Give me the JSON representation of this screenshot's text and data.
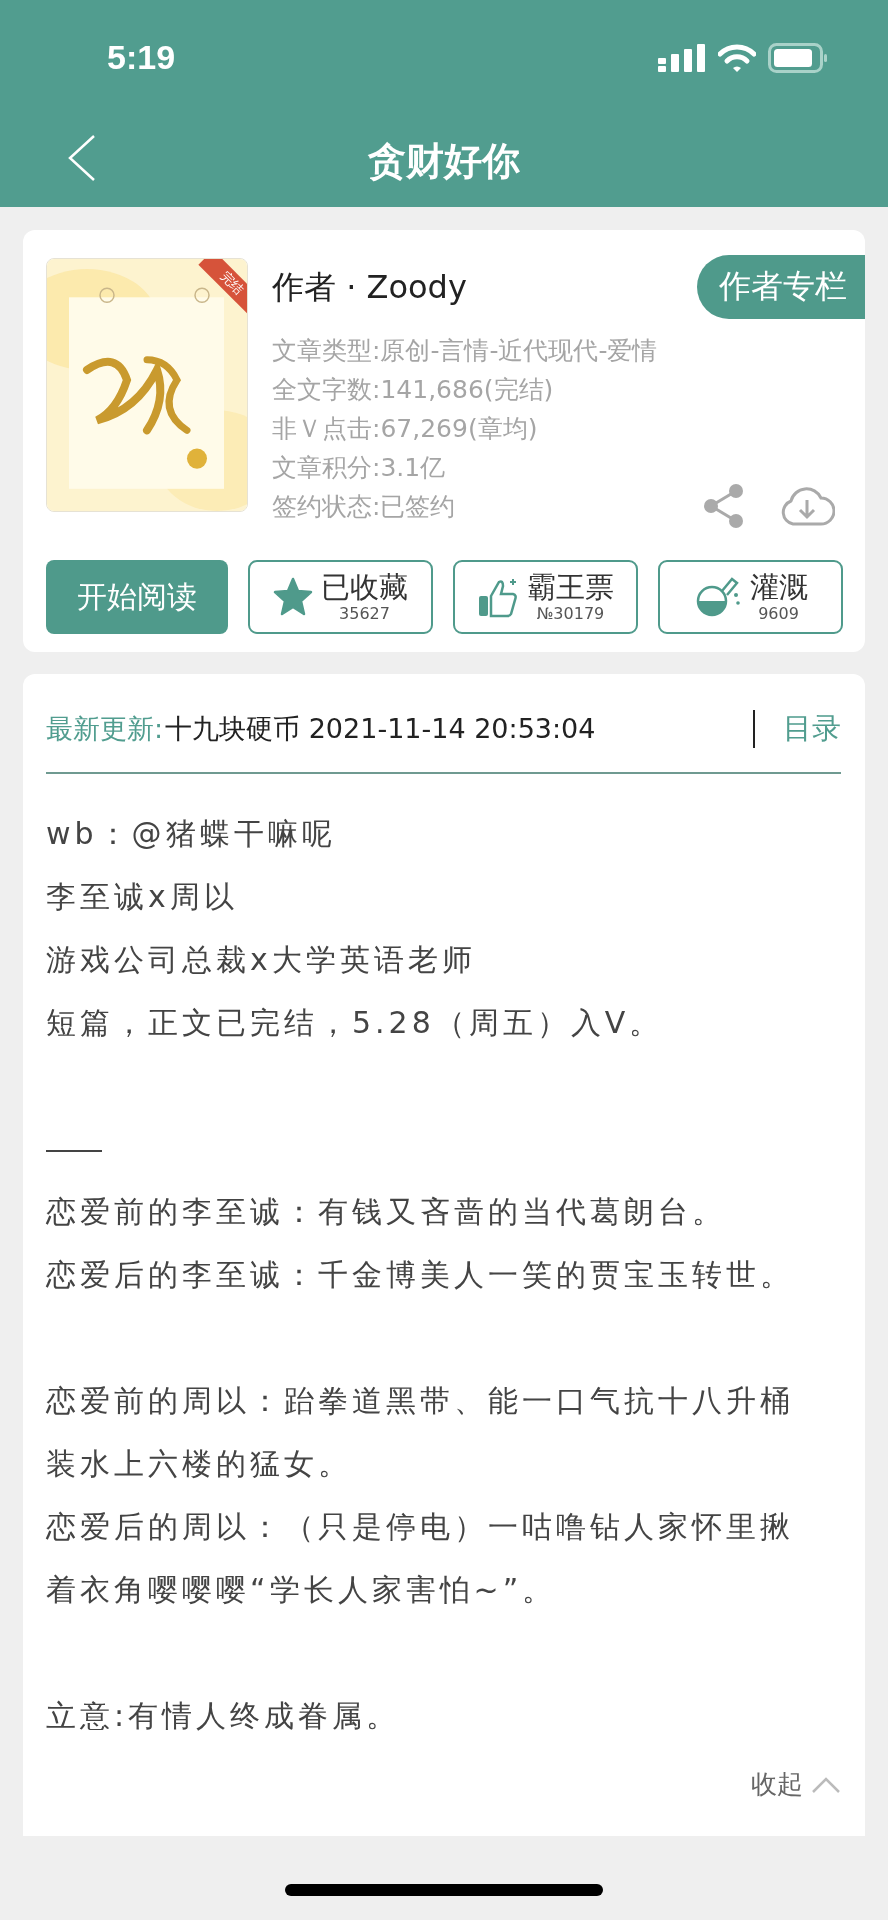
{
  "status_bar": {
    "time": "5:19"
  },
  "nav": {
    "title": "贪财好你"
  },
  "book": {
    "cover_badge": "完结",
    "author": "作者 · Zoody",
    "author_button": "作者专栏",
    "info": [
      "文章类型:原创-言情-近代现代-爱情",
      "全文字数:141,686(完结)",
      "非Ｖ点击:67,269(章均)",
      "文章积分:3.1亿",
      "签约状态:已签约"
    ],
    "read_button": "开始阅读",
    "actions": [
      {
        "kind": "favorite",
        "label": "已收藏",
        "count": "35627",
        "active": true
      },
      {
        "kind": "vote",
        "label": "霸王票",
        "count": "№30179"
      },
      {
        "kind": "water",
        "label": "灌溉",
        "count": "9609"
      }
    ]
  },
  "update": {
    "label": "最新更新:",
    "text": "十九块硬币 2021-11-14 20:53:04",
    "toc": "目录"
  },
  "intro": [
    {
      "kind": "text",
      "text": "wb：@猪蝶干嘛呢"
    },
    {
      "kind": "text",
      "text": "李至诚x周以"
    },
    {
      "kind": "text",
      "text": "游戏公司总裁x大学英语老师"
    },
    {
      "kind": "text",
      "text": "短篇，正文已完结，5.28（周五）入V。"
    },
    {
      "kind": "blank"
    },
    {
      "kind": "rule"
    },
    {
      "kind": "text",
      "text": "恋爱前的李至诚：有钱又吝啬的当代葛朗台。"
    },
    {
      "kind": "text",
      "text": "恋爱后的李至诚：千金博美人一笑的贾宝玉转世。"
    },
    {
      "kind": "blank"
    },
    {
      "kind": "text",
      "text": "恋爱前的周以：跆拳道黑带、能一口气抗十八升桶装水上六楼的猛女。"
    },
    {
      "kind": "text",
      "text": "恋爱后的周以：（只是停电）一咕噜钻人家怀里揪着衣角嘤嘤嘤“学长人家害怕~”。"
    },
    {
      "kind": "blank"
    },
    {
      "kind": "text",
      "text": "立意:有情人终成眷属。"
    }
  ],
  "collapse": "收起"
}
